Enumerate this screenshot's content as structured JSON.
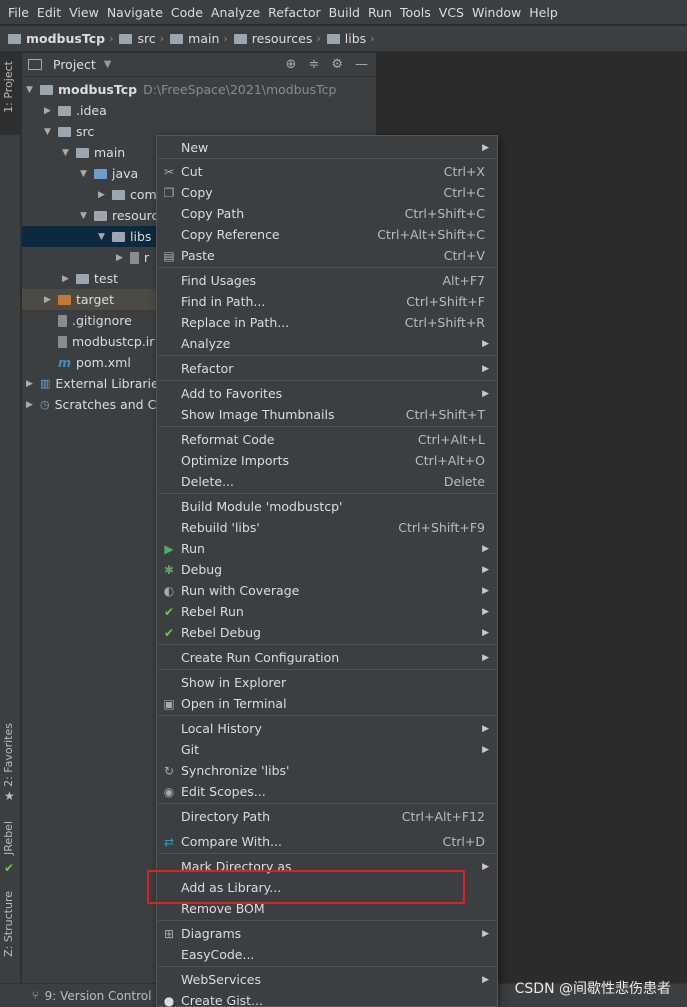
{
  "menubar": [
    "File",
    "Edit",
    "View",
    "Navigate",
    "Code",
    "Analyze",
    "Refactor",
    "Build",
    "Run",
    "Tools",
    "VCS",
    "Window",
    "Help"
  ],
  "breadcrumb": [
    "modbusTcp",
    "src",
    "main",
    "resources",
    "libs"
  ],
  "left_tabs": {
    "project": "1: Project",
    "favorites": "2: Favorites",
    "jrebel": "JRebel",
    "structure": "Z: Structure"
  },
  "panel": {
    "title": "Project"
  },
  "tree": [
    {
      "name": "modbusTcp",
      "path": "D:\\FreeSpace\\2021\\modbusTcp"
    },
    {
      "name": ".idea"
    },
    {
      "name": "src"
    },
    {
      "name": "main"
    },
    {
      "name": "java"
    },
    {
      "name": "com"
    },
    {
      "name": "resourc"
    },
    {
      "name": "libs"
    },
    {
      "name": "r"
    },
    {
      "name": "test"
    },
    {
      "name": "target"
    },
    {
      "name": ".gitignore"
    },
    {
      "name": "modbustcp.ir"
    },
    {
      "name": "pom.xml"
    },
    {
      "name": "External Librarie"
    },
    {
      "name": "Scratches and Co"
    }
  ],
  "bottom": {
    "version_control": "9: Version Control"
  },
  "watermark": "CSDN @间歇性悲伤患者",
  "menu": {
    "new": "New",
    "cut": "Cut",
    "cut_sc": "Ctrl+X",
    "copy": "Copy",
    "copy_sc": "Ctrl+C",
    "copy_path": "Copy Path",
    "copy_path_sc": "Ctrl+Shift+C",
    "copy_ref": "Copy Reference",
    "copy_ref_sc": "Ctrl+Alt+Shift+C",
    "paste": "Paste",
    "paste_sc": "Ctrl+V",
    "find_usages": "Find Usages",
    "find_usages_sc": "Alt+F7",
    "find_in_path": "Find in Path...",
    "find_in_path_sc": "Ctrl+Shift+F",
    "replace_in_path": "Replace in Path...",
    "replace_in_path_sc": "Ctrl+Shift+R",
    "analyze": "Analyze",
    "refactor": "Refactor",
    "add_favorites": "Add to Favorites",
    "show_thumbs": "Show Image Thumbnails",
    "show_thumbs_sc": "Ctrl+Shift+T",
    "reformat": "Reformat Code",
    "reformat_sc": "Ctrl+Alt+L",
    "optimize": "Optimize Imports",
    "optimize_sc": "Ctrl+Alt+O",
    "delete": "Delete...",
    "delete_sc": "Delete",
    "build_module": "Build Module 'modbustcp'",
    "rebuild": "Rebuild 'libs'",
    "rebuild_sc": "Ctrl+Shift+F9",
    "run": "Run",
    "debug": "Debug",
    "run_coverage": "Run with Coverage",
    "rebel_run": "Rebel Run",
    "rebel_debug": "Rebel Debug",
    "create_run": "Create Run Configuration",
    "show_explorer": "Show in Explorer",
    "open_terminal": "Open in Terminal",
    "local_history": "Local History",
    "git": "Git",
    "synchronize": "Synchronize 'libs'",
    "edit_scopes": "Edit Scopes...",
    "dir_path": "Directory Path",
    "dir_path_sc": "Ctrl+Alt+F12",
    "compare": "Compare With...",
    "compare_sc": "Ctrl+D",
    "mark_dir": "Mark Directory as",
    "add_library": "Add as Library...",
    "remove_bom": "Remove BOM",
    "diagrams": "Diagrams",
    "easycode": "EasyCode...",
    "webservices": "WebServices",
    "create_gist": "Create Gist..."
  },
  "colors": {
    "highlight_box": "#e02020",
    "selection": "#0d293e",
    "menu_bg": "#3c3f41"
  }
}
